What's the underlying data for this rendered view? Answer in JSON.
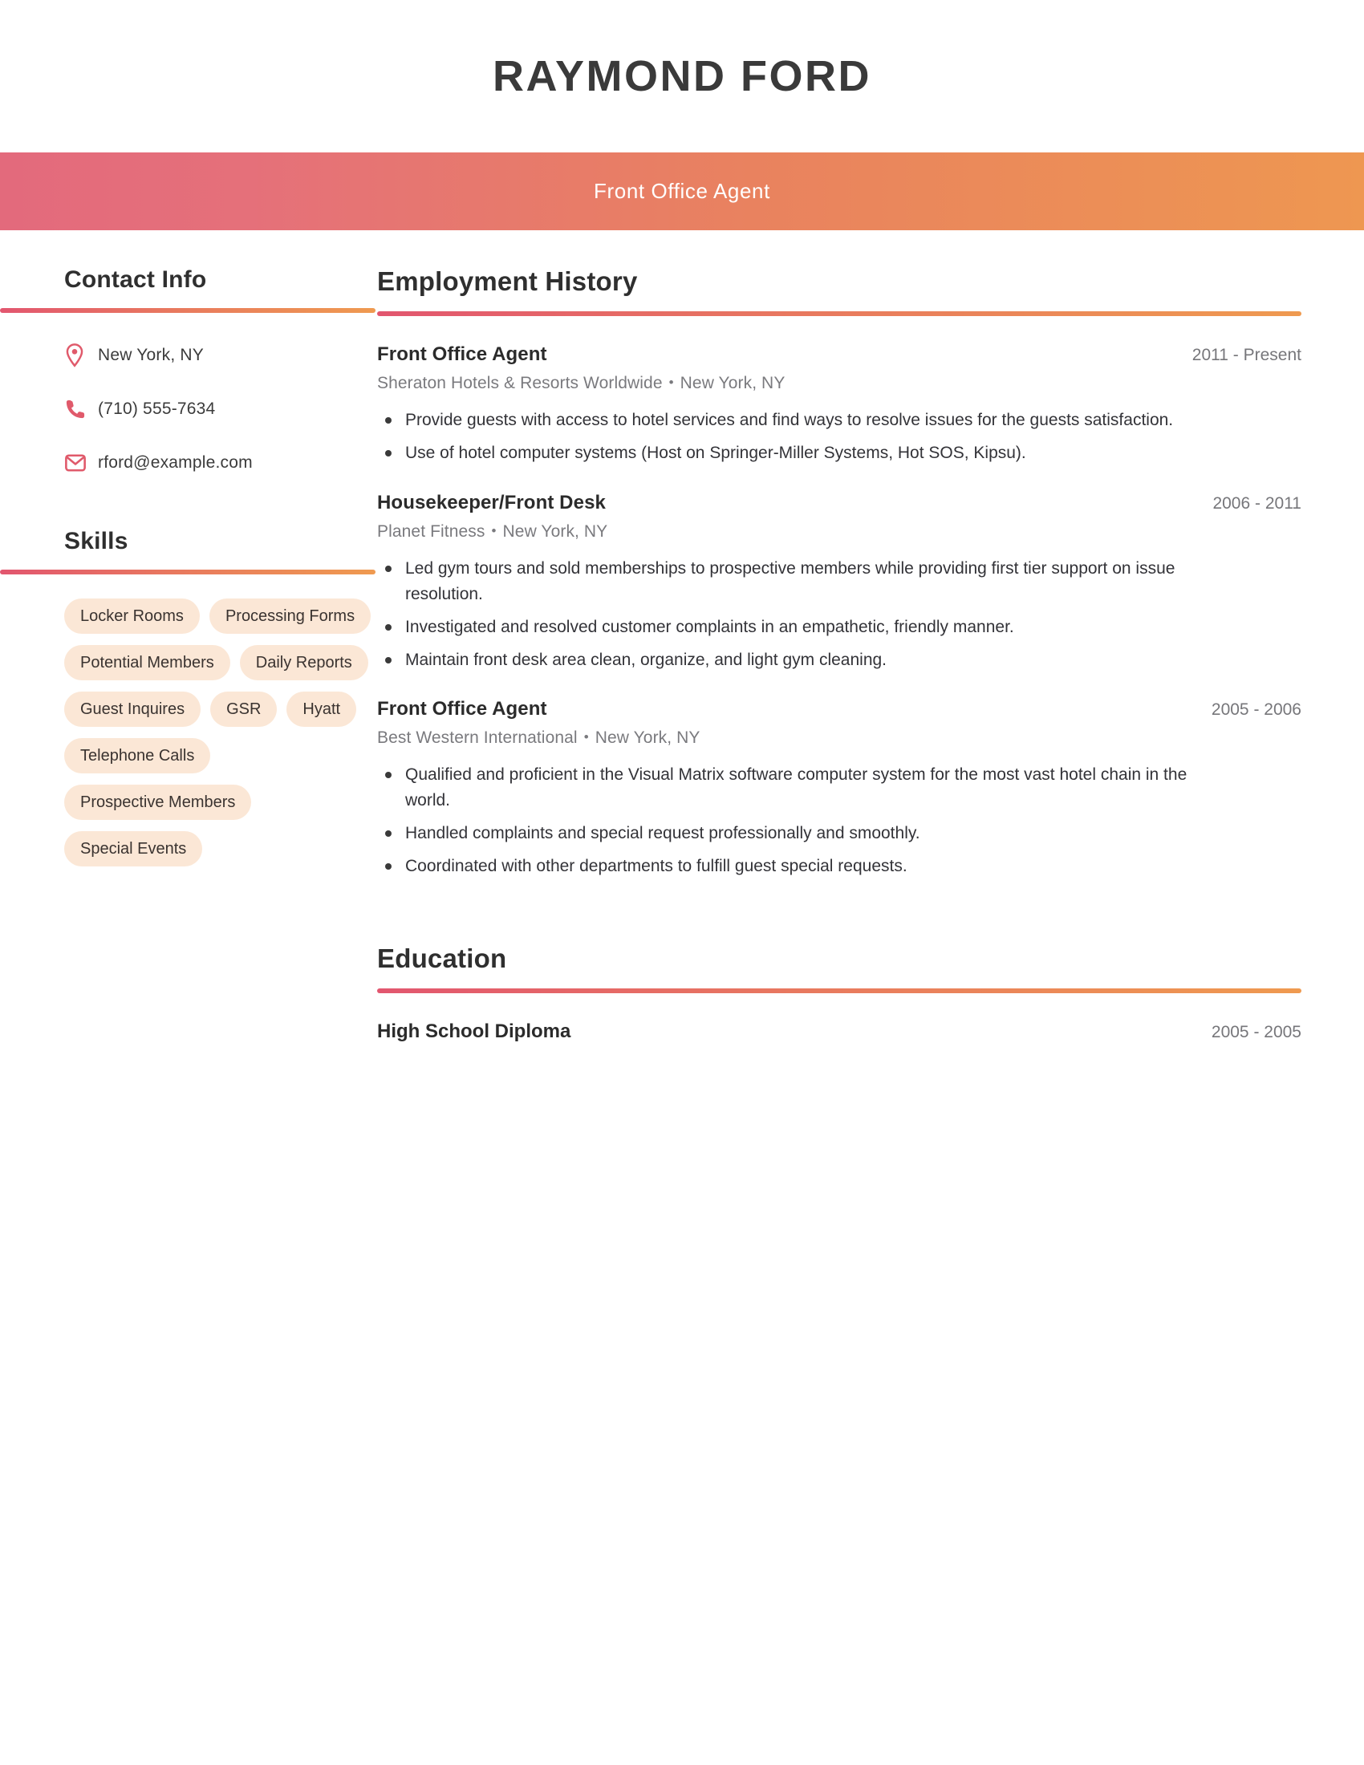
{
  "header": {
    "name": "RAYMOND FORD",
    "job_title": "Front Office Agent"
  },
  "theme": {
    "gradient_start": "#e2566f",
    "gradient_end": "#ef9a50",
    "icon_color": "#e05a6b",
    "pill_bg": "#fbe7d6",
    "heading_color": "#2f2f2f",
    "date_color": "#76767a"
  },
  "sidebar": {
    "contact": {
      "heading": "Contact Info",
      "items": [
        {
          "icon": "location-pin-icon",
          "value": "New York, NY"
        },
        {
          "icon": "phone-icon",
          "value": "(710) 555-7634"
        },
        {
          "icon": "envelope-icon",
          "value": "rford@example.com"
        }
      ]
    },
    "skills": {
      "heading": "Skills",
      "items": [
        "Locker Rooms",
        "Processing Forms",
        "Potential Members",
        "Daily Reports",
        "Guest Inquires",
        "GSR",
        "Hyatt",
        "Telephone Calls",
        "Prospective Members",
        "Special Events"
      ]
    }
  },
  "main": {
    "employment": {
      "heading": "Employment History",
      "entries": [
        {
          "role": "Front Office Agent",
          "dates": "2011 - Present",
          "company": "Sheraton Hotels & Resorts Worldwide",
          "separator": "•",
          "location": "New York, NY",
          "bullets": [
            "Provide guests with access to hotel services and find ways to resolve issues for the guests satisfaction.",
            "Use of hotel computer systems (Host on Springer-Miller Systems, Hot SOS, Kipsu)."
          ]
        },
        {
          "role": "Housekeeper/Front Desk",
          "dates": "2006 - 2011",
          "company": "Planet Fitness",
          "separator": "•",
          "location": "New York, NY",
          "bullets": [
            "Led gym tours and sold memberships to prospective members while providing first tier support on issue resolution.",
            "Investigated and resolved customer complaints in an empathetic, friendly manner.",
            "Maintain front desk area clean, organize, and light gym cleaning."
          ]
        },
        {
          "role": "Front Office Agent",
          "dates": "2005 - 2006",
          "company": "Best Western International",
          "separator": "•",
          "location": "New York, NY",
          "bullets": [
            "Qualified and proficient in the Visual Matrix software computer system for the most vast hotel chain in the world.",
            "Handled complaints and special request professionally and smoothly.",
            "Coordinated with other departments to fulfill guest special requests."
          ]
        }
      ]
    },
    "education": {
      "heading": "Education",
      "entries": [
        {
          "degree": "High School Diploma",
          "dates": "2005 - 2005"
        }
      ]
    }
  }
}
